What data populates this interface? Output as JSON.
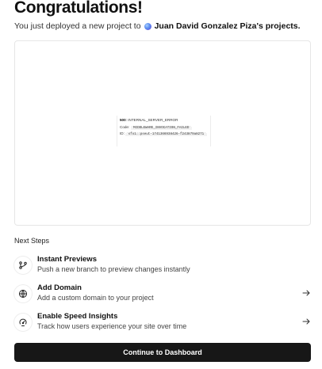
{
  "header": {
    "title": "Congratulations!",
    "subtitle_prefix": "You just deployed a new project to",
    "owner_name": "Juan David Gonzalez Piza's projects."
  },
  "preview": {
    "error_code": "500",
    "error_title": ": INTERNAL_SERVER_ERROR",
    "code_label": "Code:",
    "code_value": "`MIDDLEWARE_INVOCATION_FAILED`",
    "id_label": "ID:",
    "id_value": "`sfo1::pseut-1741366938426-f243879a8271`"
  },
  "next_steps": {
    "label": "Next Steps",
    "items": [
      {
        "title": "Instant Previews",
        "description": "Push a new branch to preview changes instantly",
        "icon": "git-branch-icon"
      },
      {
        "title": "Add Domain",
        "description": "Add a custom domain to your project",
        "icon": "globe-icon"
      },
      {
        "title": "Enable Speed Insights",
        "description": "Track how users experience your site over time",
        "icon": "gauge-icon"
      }
    ]
  },
  "cta": {
    "label": "Continue to Dashboard"
  }
}
